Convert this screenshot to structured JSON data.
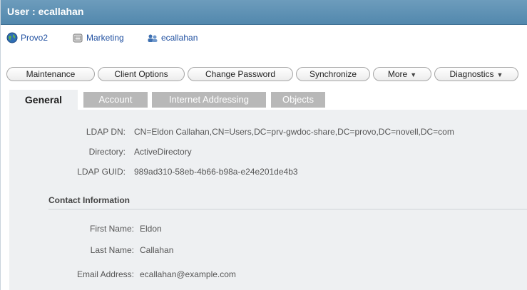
{
  "window": {
    "title": "User : ecallahan"
  },
  "breadcrumb": [
    {
      "label": "Provo2",
      "icon": "globe-icon"
    },
    {
      "label": "Marketing",
      "icon": "post-office-icon"
    },
    {
      "label": "ecallahan",
      "icon": "users-icon"
    }
  ],
  "actions": {
    "maintenance": "Maintenance",
    "client_options": "Client Options",
    "change_password": "Change Password",
    "synchronize": "Synchronize",
    "more": "More",
    "diagnostics": "Diagnostics"
  },
  "tabs": {
    "general": "General",
    "account": "Account",
    "internet_addressing": "Internet Addressing",
    "objects": "Objects",
    "active": "General"
  },
  "general": {
    "ldap_dn_label": "LDAP DN:",
    "ldap_dn_value": "CN=Eldon Callahan,CN=Users,DC=prv-gwdoc-share,DC=provo,DC=novell,DC=com",
    "directory_label": "Directory:",
    "directory_value": "ActiveDirectory",
    "ldap_guid_label": "LDAP GUID:",
    "ldap_guid_value": "989ad310-58eb-4b66-b98a-e24e201de4b3"
  },
  "contact": {
    "section_title": "Contact Information",
    "first_name_label": "First Name:",
    "first_name_value": "Eldon",
    "last_name_label": "Last Name:",
    "last_name_value": "Callahan",
    "email_label": "Email Address:",
    "email_value": "ecallahan@example.com"
  },
  "colors": {
    "title_bar": "#5a8fb2",
    "link": "#1f4fa0",
    "tab_inactive": "#b8b8b8",
    "content_bg": "#eef0f2"
  }
}
